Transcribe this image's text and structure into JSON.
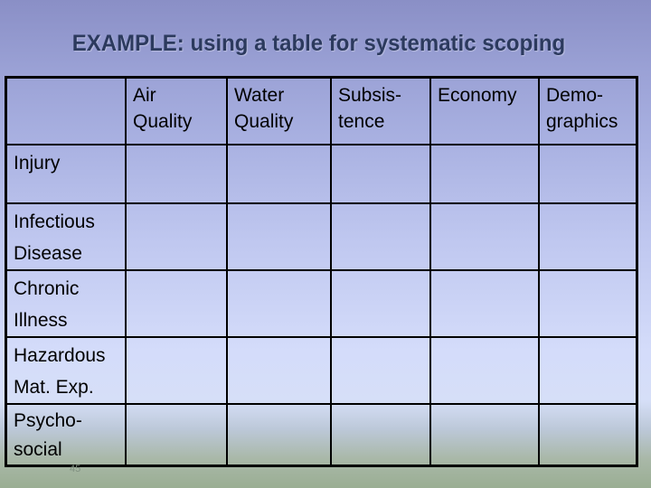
{
  "slide": {
    "title": "EXAMPLE:  using a table for systematic scoping",
    "page_number": "45"
  },
  "table": {
    "corner": "",
    "columns": [
      {
        "line1": "Air",
        "line2": "Quality"
      },
      {
        "line1": "Water",
        "line2": "Quality"
      },
      {
        "line1": "Subsis-",
        "line2": "tence"
      },
      {
        "line1": "Economy",
        "line2": ""
      },
      {
        "line1": "Demo-",
        "line2": "graphics"
      }
    ],
    "rows": [
      {
        "line1": "Injury",
        "line2": "",
        "cells": [
          "",
          "",
          "",
          "",
          ""
        ]
      },
      {
        "line1": "Infectious",
        "line2": "Disease",
        "cells": [
          "",
          "",
          "",
          "",
          ""
        ]
      },
      {
        "line1": "Chronic",
        "line2": "Illness",
        "cells": [
          "",
          "",
          "",
          "",
          ""
        ]
      },
      {
        "line1": "Hazardous",
        "line2": "Mat. Exp.",
        "cells": [
          "",
          "",
          "",
          "",
          ""
        ]
      },
      {
        "line1": "Psycho-",
        "line2": "social",
        "cells": [
          "",
          "",
          "",
          "",
          ""
        ]
      }
    ]
  }
}
